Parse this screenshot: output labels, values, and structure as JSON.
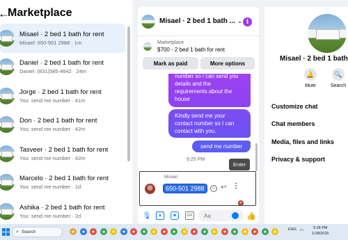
{
  "sidebar": {
    "title": "Marketplace",
    "conversations": [
      {
        "name": "Misael · 2 bed 1 bath for rent",
        "preview": "Misael: 650-501 2988 · 1m"
      },
      {
        "name": "Daniel · 2 bed 1 bath for rent",
        "preview": "Daniel: (831)585-4642 · 24m"
      },
      {
        "name": "Jorge · 2 bed 1 bath for rent",
        "preview": "You: send me number · 41m"
      },
      {
        "name": "Don · 2 bed 1 bath for rent",
        "preview": "You: send me number · 42m"
      },
      {
        "name": "Tasveer · 2 bed 1 bath for rent",
        "preview": "You: send me number · 42m"
      },
      {
        "name": "Marcelo · 2 bed 1 bath for rent",
        "preview": "You: send me number · 1d"
      },
      {
        "name": "Ashika · 2 bed 1 bath for rent",
        "preview": "You: send me number · 2d"
      }
    ]
  },
  "chat": {
    "title": "Misael · 2 bed 1 bath ...",
    "listing_label": "Marketplace",
    "listing_price": "$700 - 2 bed 1 bath for rent",
    "mark_paid_label": "Mark as paid",
    "more_options_label": "More options",
    "messages": [
      "number so i can send you details and the requirements about the house",
      "Kindly send me your contact number so I can contact with you.",
      "send me number"
    ],
    "timestamp": "9:25 PM",
    "tooltip": "Enter",
    "sender_name": "Misael",
    "received_message": "650-501 2988",
    "composer_placeholder": "Aa"
  },
  "details": {
    "title": "Misael · 2 bed 1 bath",
    "actions": [
      {
        "label": "Mute",
        "icon": "bell-icon"
      },
      {
        "label": "Search",
        "icon": "search-icon"
      }
    ],
    "menu": [
      "Customize chat",
      "Chat members",
      "Media, files and links",
      "Privacy & support"
    ]
  },
  "taskbar": {
    "search_placeholder": "Search",
    "tray_text": "ENG",
    "time": "9:28 PM",
    "date": "1/18/2026"
  },
  "colors": {
    "accent": "#0a7cff",
    "bubble_purple": "#9b3ff0",
    "bubble_blue": "#5b5df3",
    "selected_row": "#e7f0fb"
  }
}
